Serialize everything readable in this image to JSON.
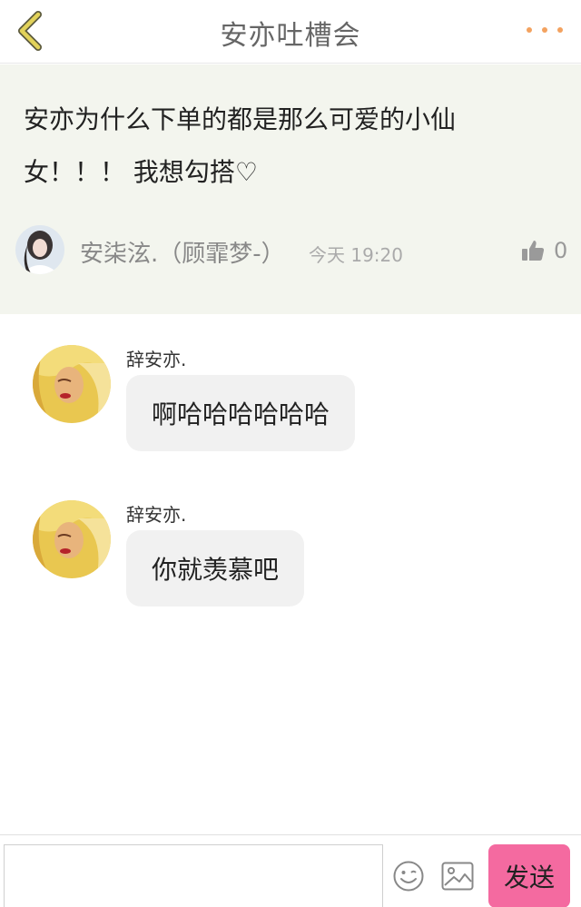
{
  "header": {
    "title": "安亦吐槽会",
    "back_icon": "chevron-left-icon",
    "more_icon": "more-dots-icon",
    "accent_color": "#f3a25f",
    "back_color": "#e2d25a"
  },
  "post": {
    "text": "安亦为什么下单的都是那么可爱的小仙女！！！ 我想勾搭♡",
    "author": "安柒泫.（顾霏梦-）",
    "time": "今天 19:20",
    "like_count": "0",
    "like_icon": "thumbs-up-icon",
    "background_color": "#f3f5ee"
  },
  "messages": [
    {
      "name": "辞安亦.",
      "text": "啊哈哈哈哈哈哈"
    },
    {
      "name": "辞安亦.",
      "text": "你就羡慕吧"
    }
  ],
  "composer": {
    "input_value": "",
    "emoji_icon": "emoji-icon",
    "image_icon": "image-icon",
    "send_label": "发送",
    "send_color": "#f46aa0"
  }
}
